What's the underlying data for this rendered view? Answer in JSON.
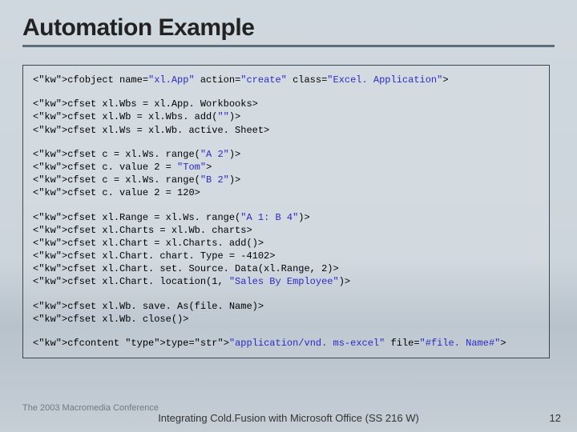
{
  "title": "Automation Example",
  "code": {
    "l1": "<cfobject name=\"xl.App\" action=\"create\" class=\"Excel. Application\">",
    "l2": "<cfset xl.Wbs = xl.App. Workbooks>",
    "l3": "<cfset xl.Wb = xl.Wbs. add(\"\")>",
    "l4": "<cfset xl.Ws = xl.Wb. active. Sheet>",
    "l5": "<cfset c = xl.Ws. range(\"A 2\")>",
    "l6": "<cfset c. value 2 = \"Tom\">",
    "l7": "<cfset c = xl.Ws. range(\"B 2\")>",
    "l8": "<cfset c. value 2 = 120>",
    "l9": "<cfset xl.Range = xl.Ws. range(\"A 1: B 4\")>",
    "l10": "<cfset xl.Charts = xl.Wb. charts>",
    "l11": "<cfset xl.Chart = xl.Charts. add()>",
    "l12": "<cfset xl.Chart. chart. Type = -4102>",
    "l13": "<cfset xl.Chart. set. Source. Data(xl.Range, 2)>",
    "l14": "<cfset xl.Chart. location(1, \"Sales By Employee\")>",
    "l15": "<cfset xl.Wb. save. As(file. Name)>",
    "l16": "<cfset xl.Wb. close()>",
    "l17": "<cfcontent type=\"application/vnd. ms-excel\" file=\"#file. Name#\">"
  },
  "conference": "The 2003 Macromedia Conference",
  "footer": "Integrating Cold.Fusion with Microsoft Office (SS 216 W)",
  "page": "12"
}
